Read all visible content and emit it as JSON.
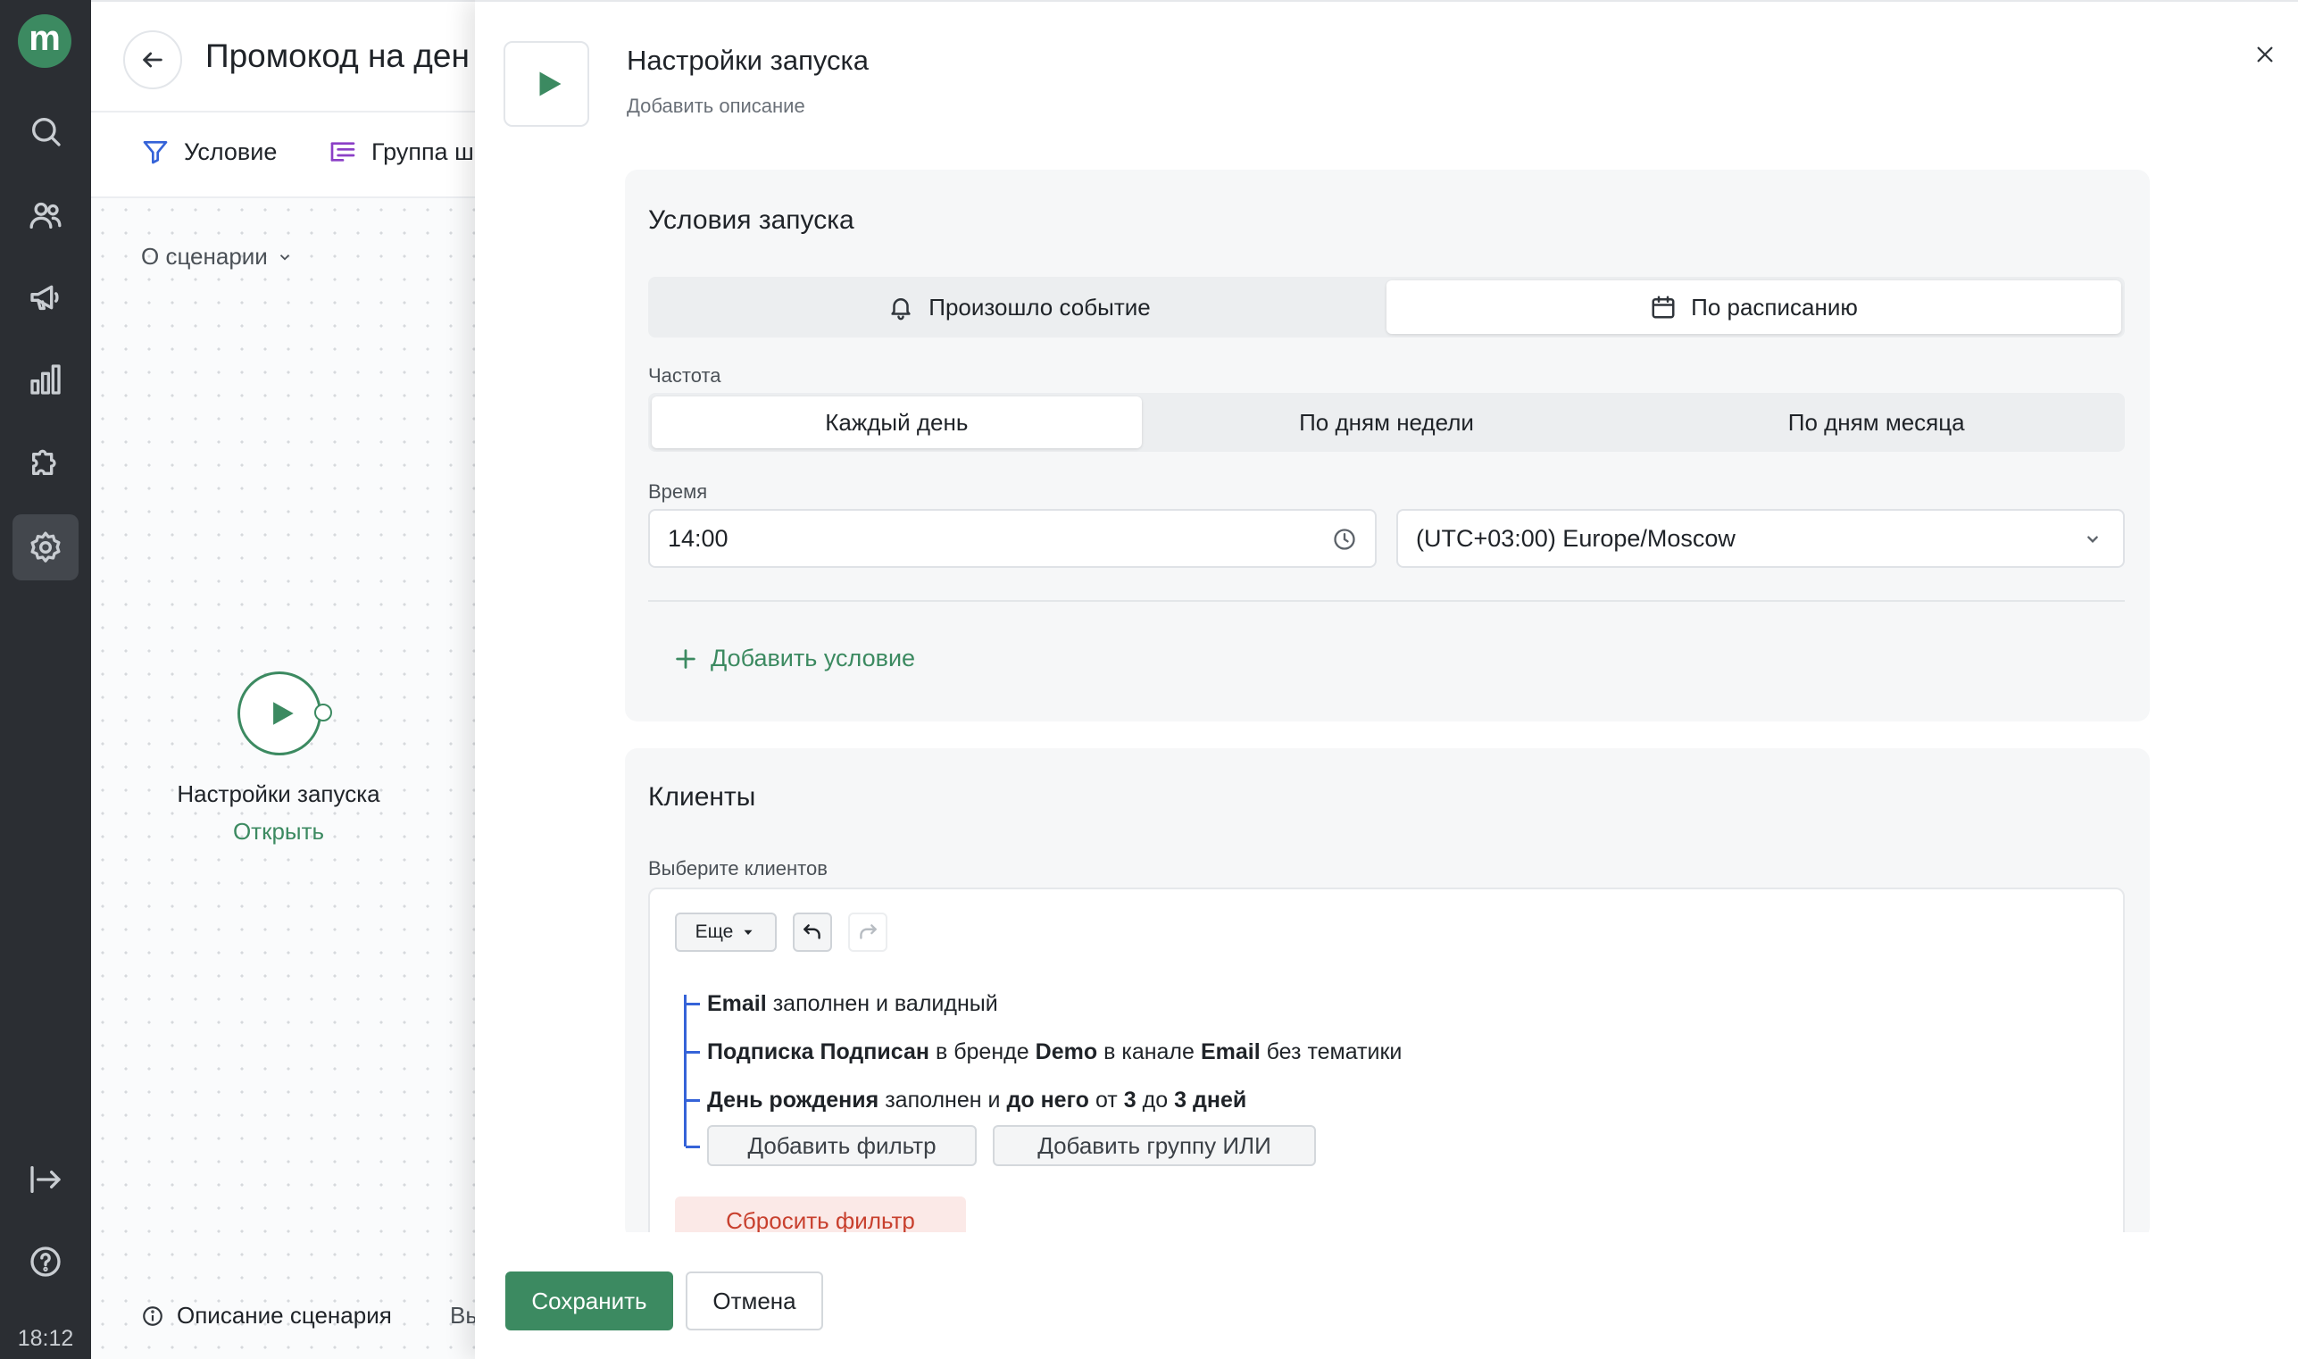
{
  "rail": {
    "logo_letter": "m",
    "items": [
      {
        "icon": "search-icon"
      },
      {
        "icon": "users-icon"
      },
      {
        "icon": "megaphone-icon"
      },
      {
        "icon": "bar-chart-icon"
      },
      {
        "icon": "puzzle-icon"
      },
      {
        "icon": "gear-icon",
        "active": true
      },
      {
        "icon": "logout-icon"
      },
      {
        "icon": "help-icon"
      }
    ],
    "clock": "18:12"
  },
  "scenario": {
    "title": "Промокод на ден",
    "toolbar": {
      "condition_label": "Условие",
      "group_label": "Группа ш"
    },
    "about_label": "О сценарии",
    "node": {
      "label": "Настройки запуска",
      "open_link": "Открыть"
    },
    "description_label": "Описание сценария",
    "description_more": "Вы"
  },
  "panel": {
    "title": "Настройки запуска",
    "add_description": "Добавить описание",
    "launch_conditions": {
      "heading": "Условия запуска",
      "trigger_tabs": [
        {
          "label": "Произошло событие",
          "icon": "bell-icon",
          "selected": false
        },
        {
          "label": "По расписанию",
          "icon": "calendar-icon",
          "selected": true
        }
      ],
      "frequency_label": "Частота",
      "frequency_options": [
        {
          "label": "Каждый день",
          "selected": true
        },
        {
          "label": "По дням недели",
          "selected": false
        },
        {
          "label": "По дням месяца",
          "selected": false
        }
      ],
      "time_label": "Время",
      "time_value": "14:00",
      "timezone_value": "(UTC+03:00) Europe/Moscow",
      "add_condition": "Добавить условие"
    },
    "clients": {
      "heading": "Клиенты",
      "select_label": "Выберите клиентов",
      "more_button": "Еще",
      "filters": [
        [
          {
            "t": "Email",
            "b": true
          },
          {
            "t": "заполнен и валидный",
            "b": false
          }
        ],
        [
          {
            "t": "Подписка Подписан",
            "b": true
          },
          {
            "t": "в бренде",
            "b": false
          },
          {
            "t": "Demo",
            "b": true
          },
          {
            "t": "в канале",
            "b": false
          },
          {
            "t": "Email",
            "b": true
          },
          {
            "t": "без тематики",
            "b": false
          }
        ],
        [
          {
            "t": "День рождения",
            "b": true
          },
          {
            "t": "заполнен и",
            "b": false
          },
          {
            "t": "до него",
            "b": true
          },
          {
            "t": "от",
            "b": false
          },
          {
            "t": "3",
            "b": true
          },
          {
            "t": "до",
            "b": false
          },
          {
            "t": "3 дней",
            "b": true
          }
        ]
      ],
      "add_filter": "Добавить фильтр",
      "add_or_group": "Добавить группу ИЛИ",
      "reset_filter": "Сбросить фильтр"
    },
    "footer": {
      "save": "Сохранить",
      "cancel": "Отмена"
    }
  },
  "colors": {
    "brand_green": "#3c8a61",
    "rail_bg": "#2b2e33",
    "tree_blue": "#3563d8",
    "danger": "#c8402e"
  }
}
